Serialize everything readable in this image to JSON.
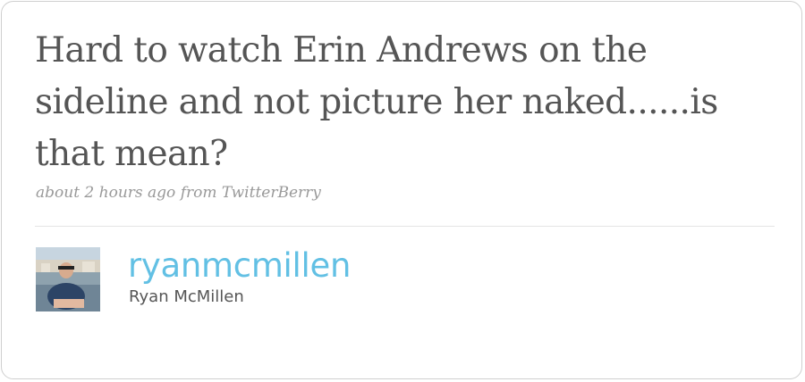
{
  "tweet": {
    "text": "Hard to watch Erin Andrews on the sideline and not picture her naked......is that mean?",
    "time": "about 2 hours ago",
    "from_label": "from",
    "source": "TwitterBerry"
  },
  "user": {
    "screen_name": "ryanmcmillen",
    "full_name": "Ryan McMillen",
    "avatar_icon": "user-avatar-photo"
  },
  "colors": {
    "screen_name": "#62c0e4",
    "tweet_text": "#555555",
    "meta": "#999999"
  }
}
